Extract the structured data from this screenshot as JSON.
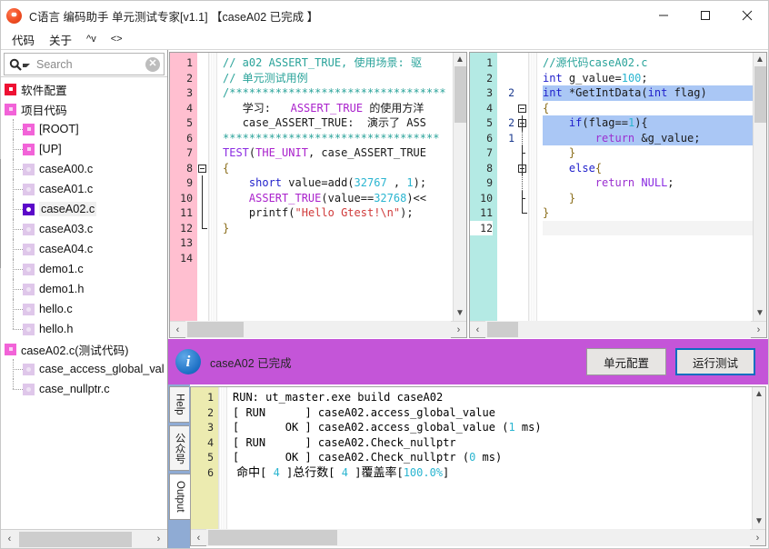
{
  "window": {
    "title": "C语言 编码助手 单元测试专家[v1.1] 【caseA02 已完成 】",
    "app_icon": "app-logo-icon",
    "minimize_label": "–",
    "maximize_label": "□",
    "close_label": "✕"
  },
  "menubar": {
    "items": [
      {
        "label": "代码",
        "name": "menu-code"
      },
      {
        "label": "关于",
        "name": "menu-about"
      },
      {
        "label": "^v",
        "name": "menu-updown"
      },
      {
        "label": "<>",
        "name": "menu-leftright"
      }
    ]
  },
  "sidebar": {
    "search": {
      "placeholder": "Search",
      "value": "",
      "icon": "search-icon",
      "clear_icon": "clear-circle-icon",
      "clear_label": "✕"
    },
    "tree": [
      {
        "label": "软件配置",
        "depth": 0,
        "icon": "config-folder-icon",
        "icon_color": "#ee1133",
        "selected": false
      },
      {
        "label": "项目代码",
        "depth": 0,
        "icon": "project-folder-icon",
        "icon_color": "#f263d8",
        "selected": false
      },
      {
        "label": "[ROOT]",
        "depth": 1,
        "icon": "root-folder-icon",
        "icon_color": "#f263d8",
        "selected": false
      },
      {
        "label": "[UP]",
        "depth": 1,
        "icon": "up-folder-icon",
        "icon_color": "#f263d8",
        "selected": false
      },
      {
        "label": "caseA00.c",
        "depth": 1,
        "icon": "c-file-icon",
        "icon_color": "#dfc7ea",
        "selected": false
      },
      {
        "label": "caseA01.c",
        "depth": 1,
        "icon": "c-file-icon",
        "icon_color": "#dfc7ea",
        "selected": false
      },
      {
        "label": "caseA02.c",
        "depth": 1,
        "icon": "c-file-icon-active",
        "icon_color": "#5b09c9",
        "selected": true
      },
      {
        "label": "caseA03.c",
        "depth": 1,
        "icon": "c-file-icon",
        "icon_color": "#dfc7ea",
        "selected": false
      },
      {
        "label": "caseA04.c",
        "depth": 1,
        "icon": "c-file-icon",
        "icon_color": "#dfc7ea",
        "selected": false
      },
      {
        "label": "demo1.c",
        "depth": 1,
        "icon": "c-file-icon",
        "icon_color": "#dfc7ea",
        "selected": false
      },
      {
        "label": "demo1.h",
        "depth": 1,
        "icon": "h-file-icon",
        "icon_color": "#dfc7ea",
        "selected": false
      },
      {
        "label": "hello.c",
        "depth": 1,
        "icon": "c-file-icon",
        "icon_color": "#dfc7ea",
        "selected": false
      },
      {
        "label": "hello.h",
        "depth": 1,
        "icon": "h-file-icon",
        "icon_color": "#dfc7ea",
        "selected": false
      },
      {
        "label": "caseA02.c(测试代码)",
        "depth": 0,
        "icon": "test-folder-icon",
        "icon_color": "#f263d8",
        "selected": false
      },
      {
        "label": "case_access_global_val",
        "depth": 1,
        "icon": "test-case-icon",
        "icon_color": "#dfc7ea",
        "selected": false
      },
      {
        "label": "case_nullptr.c",
        "depth": 1,
        "icon": "test-case-icon",
        "icon_color": "#dfc7ea",
        "selected": false
      }
    ],
    "hscroll": {
      "left_arrow": "‹",
      "right_arrow": "›"
    }
  },
  "editor_left": {
    "name": "test-code-editor",
    "gutter_color": "#ffbfd0",
    "line_count": 14,
    "lines": [
      "1",
      "2",
      "3",
      "4",
      "5",
      "6",
      "7",
      "8",
      "9",
      "10",
      "11",
      "12",
      "13",
      "14"
    ],
    "code": [
      "// a02 ASSERT_TRUE, 使用场景: 驱",
      "// 单元测试用例",
      "/*********************************",
      "   学习:   ASSERT_TRUE 的使用方洋",
      "   case_ASSERT_TRUE:  演示了 ASS",
      "*********************************",
      "TEST(THE_UNIT, case_ASSERT_TRUE",
      "{",
      "    short value=add(32767 , 1);",
      "    ASSERT_TRUE(value==32768)<<",
      "    printf(\"Hello Gtest!\\n\");",
      "}",
      "",
      ""
    ],
    "scroll": {
      "up": "⌃",
      "down": "⌄",
      "left": "‹",
      "right": "›"
    }
  },
  "editor_right": {
    "name": "source-code-editor",
    "gutter_color": "#b4eae4",
    "line_count": 12,
    "lines": [
      "1",
      "2",
      "3",
      "4",
      "5",
      "6",
      "7",
      "8",
      "9",
      "10",
      "11",
      "12"
    ],
    "coverage": [
      "",
      "",
      "2",
      "",
      "2",
      "1",
      "",
      "",
      "",
      "",
      "",
      ""
    ],
    "code": [
      "//源代码caseA02.c",
      "int g_value=100;",
      "int *GetIntData(int flag)",
      "{",
      "    if(flag==1){",
      "        return &g_value;",
      "    }",
      "    else{",
      "        return NULL;",
      "    }",
      "}",
      ""
    ],
    "highlighted_lines": [
      3,
      5,
      6
    ],
    "current_line": 12,
    "scroll": {
      "up": "⌃",
      "down": "⌄",
      "left": "‹",
      "right": "›"
    }
  },
  "statusbar": {
    "background": "#c455d8",
    "icon": "info-icon",
    "icon_label": "i",
    "message": "caseA02 已完成",
    "buttons": [
      {
        "label": "单元配置",
        "name": "unit-config-button",
        "primary": false
      },
      {
        "label": "运行测试",
        "name": "run-test-button",
        "primary": true
      }
    ]
  },
  "output": {
    "tabs": [
      {
        "label": "Help",
        "name": "tab-help",
        "active": false
      },
      {
        "label": "公众号",
        "name": "tab-wechat",
        "active": false
      },
      {
        "label": "Output",
        "name": "tab-output",
        "active": true
      }
    ],
    "gutter_color": "#ecebb0",
    "lines": [
      "1",
      "2",
      "3",
      "4",
      "5",
      "6"
    ],
    "text": [
      "RUN: ut_master.exe build caseA02",
      "[ RUN      ] caseA02.access_global_value",
      "[       OK ] caseA02.access_global_value (1 ms)",
      "[ RUN      ] caseA02.Check_nullptr",
      "[       OK ] caseA02.Check_nullptr (0 ms)",
      " 命中[ 4 ]总行数[ 4 ]覆盖率[100.0%]"
    ],
    "coverage_summary": {
      "hit_label": "命中",
      "hit": "4",
      "total_label": "总行数",
      "total": "4",
      "rate_label": "覆盖率",
      "rate": "100.0%"
    },
    "scroll": {
      "up": "⌃",
      "down": "⌄",
      "left": "‹",
      "right": "›"
    }
  },
  "colors": {
    "accent_purple": "#c455d8",
    "selected_line": "#aac7f5",
    "comment": "#2aa39a",
    "keyword": "#2222cc",
    "number": "#2ab5d0",
    "string": "#d03a3a",
    "macro": "#aa22cc"
  }
}
